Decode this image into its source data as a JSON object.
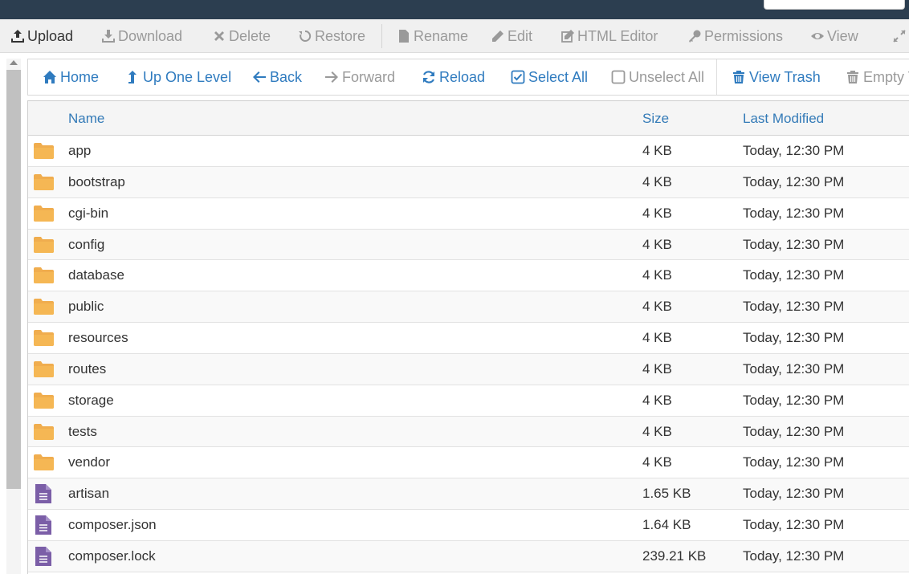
{
  "colors": {
    "topbar": "#2c3e50",
    "link": "#337ab7",
    "folder": "#f0ad4e",
    "file": "#7b5ea7",
    "disabled": "#9a9a9a"
  },
  "toolbar": {
    "upload": "Upload",
    "download": "Download",
    "delete": "Delete",
    "restore": "Restore",
    "rename": "Rename",
    "edit": "Edit",
    "html_editor": "HTML Editor",
    "permissions": "Permissions",
    "view": "View"
  },
  "nav": {
    "home": "Home",
    "up_one_level": "Up One Level",
    "back": "Back",
    "forward": "Forward",
    "reload": "Reload",
    "select_all": "Select All",
    "unselect_all": "Unselect All",
    "view_trash": "View Trash",
    "empty_trash": "Empty T"
  },
  "table": {
    "headers": {
      "name": "Name",
      "size": "Size",
      "modified": "Last Modified"
    },
    "rows": [
      {
        "type": "folder",
        "icon": "folder-icon",
        "name": "app",
        "size": "4 KB",
        "modified": "Today, 12:30 PM"
      },
      {
        "type": "folder",
        "icon": "folder-icon",
        "name": "bootstrap",
        "size": "4 KB",
        "modified": "Today, 12:30 PM"
      },
      {
        "type": "folder",
        "icon": "folder-icon",
        "name": "cgi-bin",
        "size": "4 KB",
        "modified": "Today, 12:30 PM"
      },
      {
        "type": "folder",
        "icon": "folder-icon",
        "name": "config",
        "size": "4 KB",
        "modified": "Today, 12:30 PM"
      },
      {
        "type": "folder",
        "icon": "folder-icon",
        "name": "database",
        "size": "4 KB",
        "modified": "Today, 12:30 PM"
      },
      {
        "type": "folder",
        "icon": "folder-icon",
        "name": "public",
        "size": "4 KB",
        "modified": "Today, 12:30 PM"
      },
      {
        "type": "folder",
        "icon": "folder-icon",
        "name": "resources",
        "size": "4 KB",
        "modified": "Today, 12:30 PM"
      },
      {
        "type": "folder",
        "icon": "folder-icon",
        "name": "routes",
        "size": "4 KB",
        "modified": "Today, 12:30 PM"
      },
      {
        "type": "folder",
        "icon": "folder-icon",
        "name": "storage",
        "size": "4 KB",
        "modified": "Today, 12:30 PM"
      },
      {
        "type": "folder",
        "icon": "folder-icon",
        "name": "tests",
        "size": "4 KB",
        "modified": "Today, 12:30 PM"
      },
      {
        "type": "folder",
        "icon": "folder-icon",
        "name": "vendor",
        "size": "4 KB",
        "modified": "Today, 12:30 PM"
      },
      {
        "type": "file",
        "icon": "file-text-icon",
        "name": "artisan",
        "size": "1.65 KB",
        "modified": "Today, 12:30 PM"
      },
      {
        "type": "file",
        "icon": "file-text-icon",
        "name": "composer.json",
        "size": "1.64 KB",
        "modified": "Today, 12:30 PM"
      },
      {
        "type": "file",
        "icon": "file-text-icon",
        "name": "composer.lock",
        "size": "239.21 KB",
        "modified": "Today, 12:30 PM"
      }
    ]
  }
}
